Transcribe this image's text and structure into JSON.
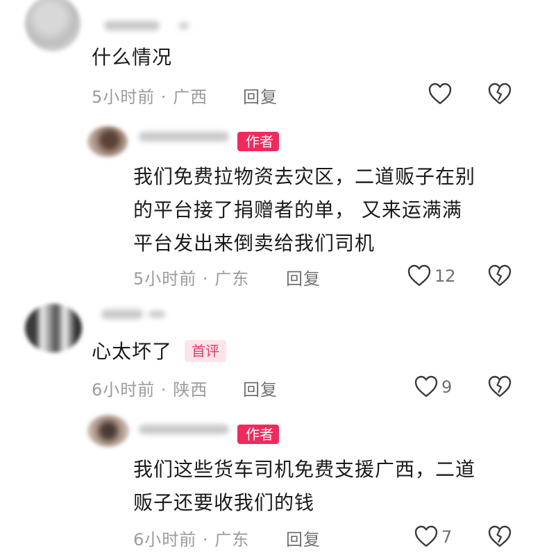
{
  "comments": [
    {
      "text": "什么情况",
      "time": "5小时前",
      "location": "广西",
      "reply_label": "回复",
      "likes": "",
      "replies": [
        {
          "badge": "作者",
          "lines": [
            "我们免费拉物资去灾区，二道贩子在别",
            "的平台接了捐赠者的单， 又来运满满",
            "平台发出来倒卖给我们司机"
          ],
          "time": "5小时前",
          "location": "广东",
          "reply_label": "回复",
          "likes": "12"
        }
      ]
    },
    {
      "text": "心太坏了",
      "badge": "首评",
      "time": "6小时前",
      "location": "陕西",
      "reply_label": "回复",
      "likes": "9",
      "replies": [
        {
          "badge": "作者",
          "lines": [
            "我们这些货车司机免费支援广西，二道",
            "贩子还要收我们的钱"
          ],
          "time": "6小时前",
          "location": "广东",
          "reply_label": "回复",
          "likes": "7"
        }
      ]
    }
  ],
  "separator": "·",
  "icons": {
    "like": "heart-outline-icon",
    "dislike": "broken-heart-icon"
  },
  "colors": {
    "author_badge": "#ef2b5c",
    "first_badge_bg": "#fde4ea",
    "first_badge_text": "#e03a64",
    "meta": "#9b9b9b"
  }
}
